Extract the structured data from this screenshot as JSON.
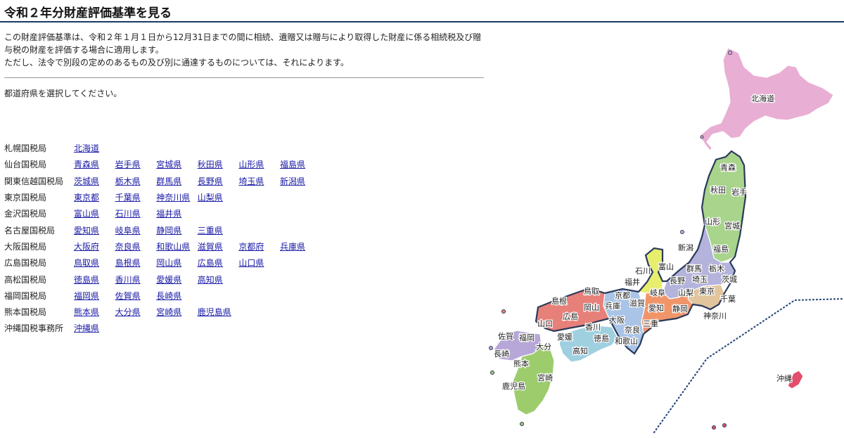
{
  "page": {
    "title": "令和２年分財産評価基準を見る",
    "intro_line1": "この財産評価基準は、令和２年１月１日から12月31日までの間に相続、遺贈又は贈与により取得した財産に係る相続税及び贈与税の財産を評価する場合に適用します。",
    "intro_line2": "ただし、法令で別段の定めのあるもの及び別に通達するものについては、それによります。",
    "instruction": "都道府県を選択してください。"
  },
  "bureaus": [
    {
      "name": "札幌国税局",
      "prefectures": [
        "北海道"
      ]
    },
    {
      "name": "仙台国税局",
      "prefectures": [
        "青森県",
        "岩手県",
        "宮城県",
        "秋田県",
        "山形県",
        "福島県"
      ]
    },
    {
      "name": "関東信越国税局",
      "prefectures": [
        "茨城県",
        "栃木県",
        "群馬県",
        "長野県",
        "埼玉県",
        "新潟県"
      ]
    },
    {
      "name": "東京国税局",
      "prefectures": [
        "東京都",
        "千葉県",
        "神奈川県",
        "山梨県"
      ]
    },
    {
      "name": "金沢国税局",
      "prefectures": [
        "富山県",
        "石川県",
        "福井県"
      ]
    },
    {
      "name": "名古屋国税局",
      "prefectures": [
        "愛知県",
        "岐阜県",
        "静岡県",
        "三重県"
      ]
    },
    {
      "name": "大阪国税局",
      "prefectures": [
        "大阪府",
        "奈良県",
        "和歌山県",
        "滋賀県",
        "京都府",
        "兵庫県"
      ]
    },
    {
      "name": "広島国税局",
      "prefectures": [
        "鳥取県",
        "島根県",
        "岡山県",
        "広島県",
        "山口県"
      ]
    },
    {
      "name": "高松国税局",
      "prefectures": [
        "徳島県",
        "香川県",
        "愛媛県",
        "高知県"
      ]
    },
    {
      "name": "福岡国税局",
      "prefectures": [
        "福岡県",
        "佐賀県",
        "長崎県"
      ]
    },
    {
      "name": "熊本国税局",
      "prefectures": [
        "熊本県",
        "大分県",
        "宮崎県",
        "鹿児島県"
      ]
    },
    {
      "name": "沖縄国税事務所",
      "prefectures": [
        "沖縄県"
      ]
    }
  ],
  "map_labels": {
    "hokkaido": "北海道",
    "aomori": "青森",
    "akita": "秋田",
    "iwate": "岩手",
    "yamagata": "山形",
    "miyagi": "宮城",
    "niigata": "新潟",
    "fukushima": "福島",
    "ishikawa": "石川",
    "toyama": "富山",
    "gunma": "群馬",
    "tochigi": "栃木",
    "fukui": "福井",
    "nagano": "長野",
    "saitama": "埼玉",
    "ibaraki": "茨城",
    "gifu": "岐阜",
    "yamanashi": "山梨",
    "tokyo": "東京",
    "chiba": "千葉",
    "kanagawa": "神奈川",
    "shiga": "滋賀",
    "aichi": "愛知",
    "shizuoka": "静岡",
    "kyoto": "京都",
    "hyogo": "兵庫",
    "osaka": "大阪",
    "mie": "三重",
    "nara": "奈良",
    "wakayama": "和歌山",
    "tottori": "鳥取",
    "shimane": "島根",
    "okayama": "岡山",
    "hiroshima": "広島",
    "yamaguchi": "山口",
    "kagawa": "香川",
    "ehime": "愛媛",
    "tokushima": "徳島",
    "kochi": "高知",
    "fukuoka": "福岡",
    "saga": "佐賀",
    "nagasaki": "長崎",
    "oita": "大分",
    "kumamoto": "熊本",
    "miyazaki": "宮崎",
    "kagoshima": "鹿児島",
    "okinawa": "沖縄"
  },
  "colors": {
    "sapporo": "#e9aed3",
    "sendai": "#a8d48b",
    "kanto_shinetsu": "#b3b3dc",
    "tokyo": "#e2c59c",
    "kanazawa": "#e7ee6e",
    "nagoya": "#f0956a",
    "osaka": "#a9c4e6",
    "hiroshima": "#e8807a",
    "takamatsu": "#9ed0e0",
    "fukuoka": "#b7a7d8",
    "kumamoto": "#9ccc6c",
    "okinawa": "#e24e6c"
  }
}
